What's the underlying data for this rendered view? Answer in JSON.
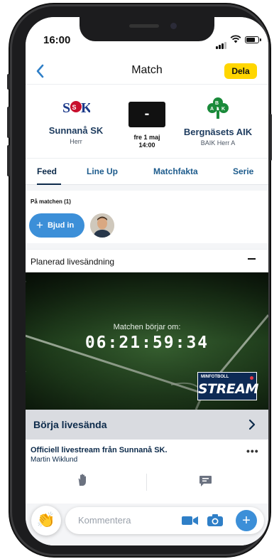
{
  "status": {
    "time": "16:00"
  },
  "nav": {
    "title": "Match",
    "share_label": "Dela"
  },
  "match": {
    "home": {
      "name": "Sunnanå SK",
      "sub": "Herr"
    },
    "away": {
      "name": "Bergnäsets AIK",
      "sub": "BAIK Herr A"
    },
    "score": "-",
    "date": "fre 1 maj",
    "time": "14:00"
  },
  "tabs": [
    {
      "label": "Feed",
      "active": true
    },
    {
      "label": "Line Up"
    },
    {
      "label": "Matchfakta"
    },
    {
      "label": "Serie"
    }
  ],
  "on_match": {
    "label": "På matchen (1)",
    "invite_label": "Bjud in"
  },
  "planned_stream": {
    "title": "Planerad livesändning"
  },
  "stream": {
    "countdown_label": "Matchen börjar om:",
    "countdown": "06:21:59:34",
    "logo_top": "MINFOTBOLL",
    "logo_main": "STREAM"
  },
  "go_live": {
    "label": "Börja livesända"
  },
  "post": {
    "title": "Officiell livestream från Sunnanå SK.",
    "author": "Martin Wiklund",
    "more": "•••"
  },
  "composer": {
    "placeholder": "Kommentera"
  },
  "icons": {
    "back": "chevron-left-icon",
    "clap": "clapping-hands-icon",
    "video": "video-camera-icon",
    "camera": "photo-camera-icon",
    "add": "plus-icon",
    "hand": "raised-hand-icon",
    "comment": "comment-icon"
  },
  "colors": {
    "accent": "#3c8fd8",
    "share": "#ffd600",
    "navy": "#0c2a4a",
    "home_red": "#c8102e",
    "away_green": "#1a8a3a"
  }
}
